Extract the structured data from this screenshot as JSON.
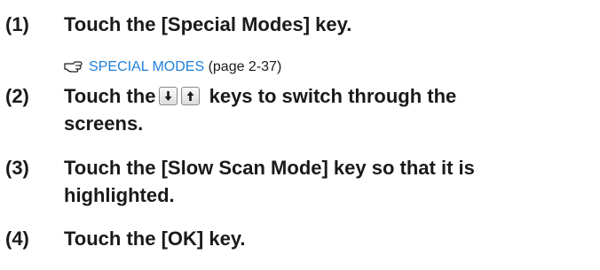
{
  "steps": [
    {
      "number": "(1)",
      "text": "Touch the [Special Modes] key.",
      "reference": {
        "icon": "reference-pointer-icon",
        "link_text": "SPECIAL MODES",
        "page_text": "(page 2-37)"
      }
    },
    {
      "number": "(2)",
      "text_before": "Touch the",
      "keys": [
        "down-arrow-key-icon",
        "up-arrow-key-icon"
      ],
      "text_after": "keys to switch through the",
      "text_line2": "screens."
    },
    {
      "number": "(3)",
      "text_line1": "Touch the [Slow Scan Mode] key so that it is",
      "text_line2": "highlighted."
    },
    {
      "number": "(4)",
      "text": "Touch the [OK] key."
    }
  ],
  "colors": {
    "link": "#1f7fd8",
    "text": "#1a1a1a"
  }
}
